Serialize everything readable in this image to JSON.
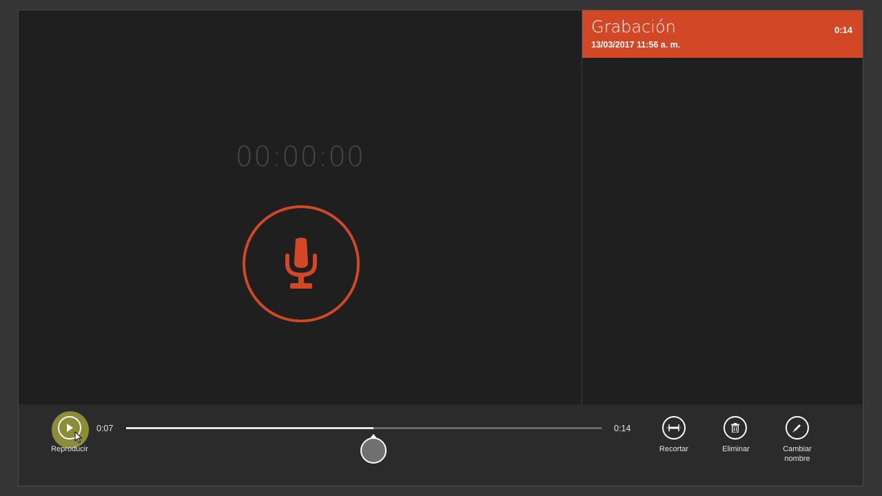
{
  "timer": {
    "display": "00:00:00"
  },
  "record_button": {
    "icon": "microphone-icon"
  },
  "recordings": [
    {
      "title": "Grabación",
      "date": "13/03/2017 11:56 a. m.",
      "duration": "0:14"
    }
  ],
  "player": {
    "play_label": "Reproducir",
    "current_time": "0:07",
    "total_time": "0:14",
    "progress": 0.52
  },
  "actions": {
    "trim_label": "Recortar",
    "delete_label": "Eliminar",
    "rename_label_line1": "Cambiar",
    "rename_label_line2": "nombre"
  },
  "colors": {
    "accent": "#d24726",
    "background": "#1f1f1f",
    "app_bar": "#2b2b2b"
  }
}
